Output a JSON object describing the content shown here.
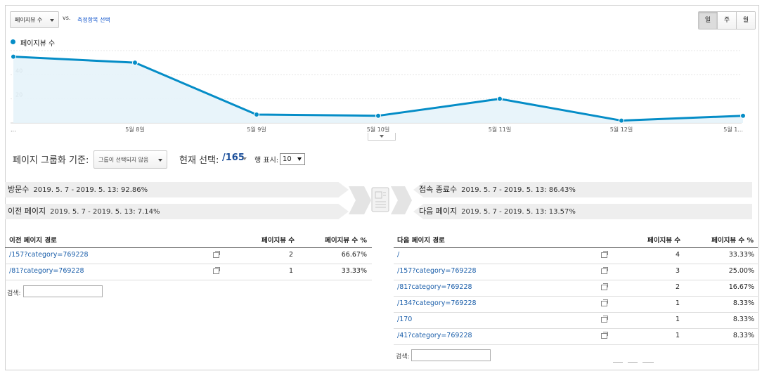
{
  "toolbar": {
    "metric_select": "페이지뷰 수",
    "vs": "vs.",
    "compare_link": "측정항목 선택",
    "period_buttons": [
      "일",
      "주",
      "월"
    ]
  },
  "chart_data": {
    "type": "area",
    "series": [
      {
        "name": "페이지뷰 수",
        "values": [
          55,
          50,
          7,
          6,
          20,
          2,
          6
        ]
      }
    ],
    "categories": [
      "...",
      "5월 8일",
      "5월 9일",
      "5월 10일",
      "5월 11일",
      "5월 12일",
      "5월 1..."
    ],
    "y_ticks": [
      "60",
      "40",
      "20"
    ],
    "ylim": [
      0,
      60
    ],
    "color": "#058dc7"
  },
  "grouping": {
    "label": "페이지 그룹화 기준:",
    "select": "그룹이 선택되지 않음",
    "current_label": "현재 선택:",
    "current_value": "/165",
    "rows_label": "행 표시:",
    "rows_value": "10"
  },
  "flow": {
    "entrances_title": "방문수",
    "entrances_text": "2019. 5. 7 - 2019. 5. 13: 92.86%",
    "previous_title": "이전 페이지",
    "previous_text": "2019. 5. 7 - 2019. 5. 13: 7.14%",
    "exits_title": "접속 종료수",
    "exits_text": "2019. 5. 7 - 2019. 5. 13: 86.43%",
    "next_title": "다음 페이지",
    "next_text": "2019. 5. 7 - 2019. 5. 13: 13.57%"
  },
  "prev_table": {
    "headers": [
      "이전 페이지 경로",
      "페이지뷰 수",
      "페이지뷰 수 %"
    ],
    "rows": [
      {
        "path": "/157?category=769228",
        "views": "2",
        "pct": "66.67%"
      },
      {
        "path": "/81?category=769228",
        "views": "1",
        "pct": "33.33%"
      }
    ],
    "search_label": "검색:"
  },
  "next_table": {
    "headers": [
      "다음 페이지 경로",
      "페이지뷰 수",
      "페이지뷰 수 %"
    ],
    "rows": [
      {
        "path": "/",
        "views": "4",
        "pct": "33.33%"
      },
      {
        "path": "/157?category=769228",
        "views": "3",
        "pct": "25.00%"
      },
      {
        "path": "/81?category=769228",
        "views": "2",
        "pct": "16.67%"
      },
      {
        "path": "/134?category=769228",
        "views": "1",
        "pct": "8.33%"
      },
      {
        "path": "/170",
        "views": "1",
        "pct": "8.33%"
      },
      {
        "path": "/41?category=769228",
        "views": "1",
        "pct": "8.33%"
      }
    ],
    "search_label": "검색:"
  }
}
